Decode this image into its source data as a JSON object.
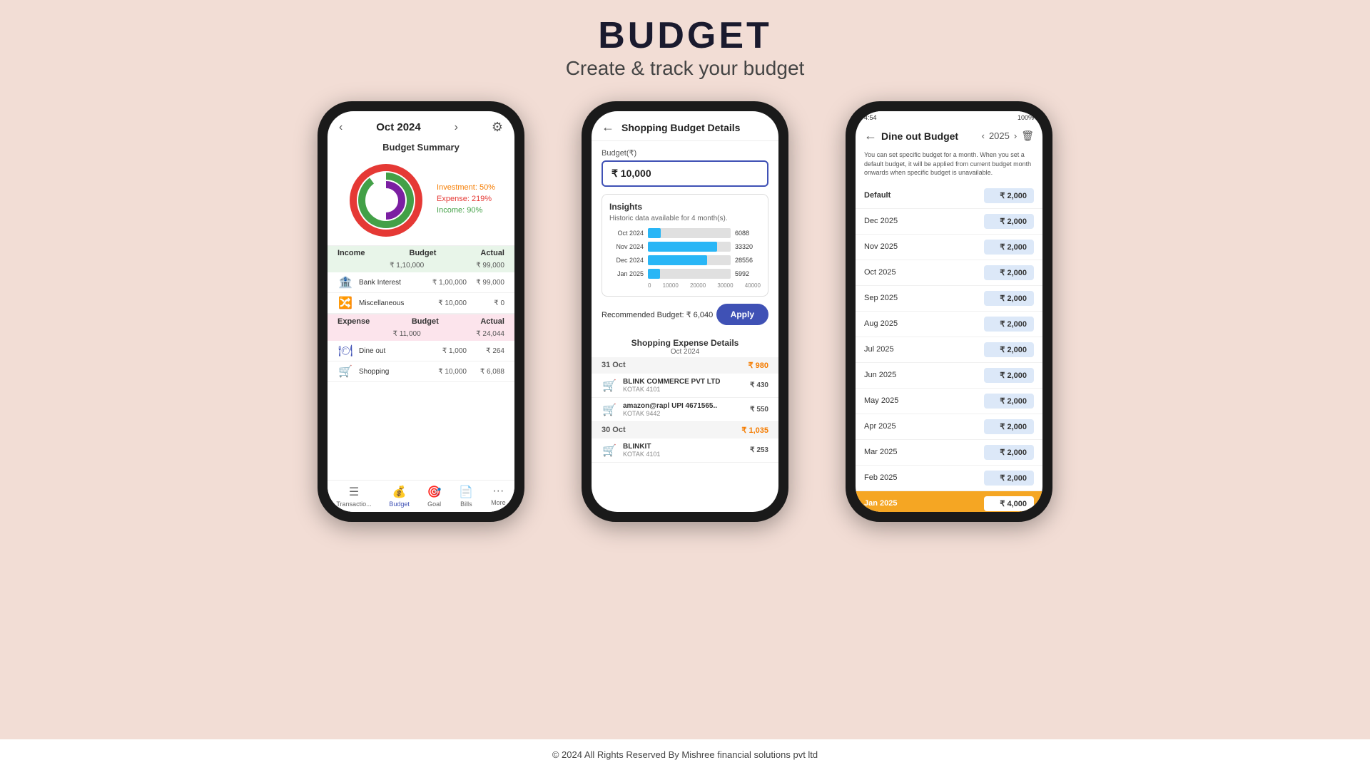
{
  "header": {
    "title": "BUDGET",
    "subtitle": "Create & track your budget"
  },
  "phone1": {
    "month": "Oct 2024",
    "summary_title": "Budget Summary",
    "legend": {
      "investment": "Investment: 50%",
      "expense": "Expense: 219%",
      "income": "Income: 90%"
    },
    "income": {
      "label": "Income",
      "budget_label": "Budget",
      "actual_label": "Actual",
      "total_budget": "₹ 1,10,000",
      "total_actual": "₹ 99,000",
      "rows": [
        {
          "icon": "🏦",
          "name": "Bank Interest",
          "budget": "₹ 1,00,000",
          "actual": "₹ 99,000"
        },
        {
          "icon": "🔀",
          "name": "Miscellaneous",
          "budget": "₹ 10,000",
          "actual": "₹ 0"
        }
      ]
    },
    "expense": {
      "label": "Expense",
      "budget_label": "Budget",
      "actual_label": "Actual",
      "total_budget": "₹ 11,000",
      "total_actual": "₹ 24,044",
      "rows": [
        {
          "icon": "🍽",
          "name": "Dine out",
          "budget": "₹ 1,000",
          "actual": "₹ 264"
        },
        {
          "icon": "🛒",
          "name": "Shopping",
          "budget": "₹ 10,000",
          "actual": "₹ 6,088"
        }
      ]
    },
    "nav": [
      {
        "label": "Transactio...",
        "icon": "☰",
        "active": false
      },
      {
        "label": "Budget",
        "icon": "💰",
        "active": true
      },
      {
        "label": "Goal",
        "icon": "🎯",
        "active": false
      },
      {
        "label": "Bills",
        "icon": "📄",
        "active": false
      },
      {
        "label": "More",
        "icon": "···",
        "active": false
      }
    ]
  },
  "phone2": {
    "header_title": "Shopping Budget Details",
    "budget_label": "Budget(₹)",
    "budget_value": "₹ 10,000",
    "insights_title": "Insights",
    "insights_subtitle": "Historic data available for 4 month(s).",
    "bar_chart": {
      "bars": [
        {
          "label": "Oct 2024",
          "value": 6088,
          "max": 40000
        },
        {
          "label": "Nov 2024",
          "value": 33320,
          "max": 40000
        },
        {
          "label": "Dec 2024",
          "value": 28556,
          "max": 40000
        },
        {
          "label": "Jan 2025",
          "value": 5992,
          "max": 40000
        }
      ],
      "axis": [
        "0",
        "10000",
        "20000",
        "30000",
        "40000"
      ]
    },
    "recommended_budget": "Recommended Budget: ₹ 6,040",
    "apply_label": "Apply",
    "expense_details": {
      "title": "Shopping Expense Details",
      "month": "Oct 2024",
      "date_groups": [
        {
          "date": "31 Oct",
          "total": "₹ 980",
          "items": [
            {
              "name": "BLINK COMMERCE PVT LTD",
              "sub": "KOTAK 4101",
              "amount": "₹ 430"
            },
            {
              "name": "amazon@rapl UPI 4671565..",
              "sub": "KOTAK 9442",
              "amount": "₹ 550"
            }
          ]
        },
        {
          "date": "30 Oct",
          "total": "₹ 1,035",
          "items": [
            {
              "name": "BLINKIT",
              "sub": "KOTAK 4101",
              "amount": "₹ 253"
            }
          ]
        }
      ]
    }
  },
  "phone3": {
    "status_bar": {
      "time": "4:54",
      "battery": "100%"
    },
    "title": "Dine out Budget",
    "year": "2025",
    "info_text": "You can set specific budget for a month. When you set a default budget, it will be applied from current budget month onwards when specific budget is unavailable.",
    "rows": [
      {
        "label": "Default",
        "value": "₹ 2,000",
        "highlight": false,
        "is_default": true
      },
      {
        "label": "Dec 2025",
        "value": "₹ 2,000",
        "highlight": false,
        "is_default": false
      },
      {
        "label": "Nov 2025",
        "value": "₹ 2,000",
        "highlight": false,
        "is_default": false
      },
      {
        "label": "Oct 2025",
        "value": "₹ 2,000",
        "highlight": false,
        "is_default": false
      },
      {
        "label": "Sep 2025",
        "value": "₹ 2,000",
        "highlight": false,
        "is_default": false
      },
      {
        "label": "Aug 2025",
        "value": "₹ 2,000",
        "highlight": false,
        "is_default": false
      },
      {
        "label": "Jul 2025",
        "value": "₹ 2,000",
        "highlight": false,
        "is_default": false
      },
      {
        "label": "Jun 2025",
        "value": "₹ 2,000",
        "highlight": false,
        "is_default": false
      },
      {
        "label": "May 2025",
        "value": "₹ 2,000",
        "highlight": false,
        "is_default": false
      },
      {
        "label": "Apr 2025",
        "value": "₹ 2,000",
        "highlight": false,
        "is_default": false
      },
      {
        "label": "Mar 2025",
        "value": "₹ 2,000",
        "highlight": false,
        "is_default": false
      },
      {
        "label": "Feb 2025",
        "value": "₹ 2,000",
        "highlight": false,
        "is_default": false
      },
      {
        "label": "Jan 2025",
        "value": "₹ 4,000",
        "highlight": true,
        "is_default": false
      }
    ]
  },
  "footer": {
    "text": "© 2024 All Rights Reserved By Mishree financial solutions pvt ltd"
  }
}
